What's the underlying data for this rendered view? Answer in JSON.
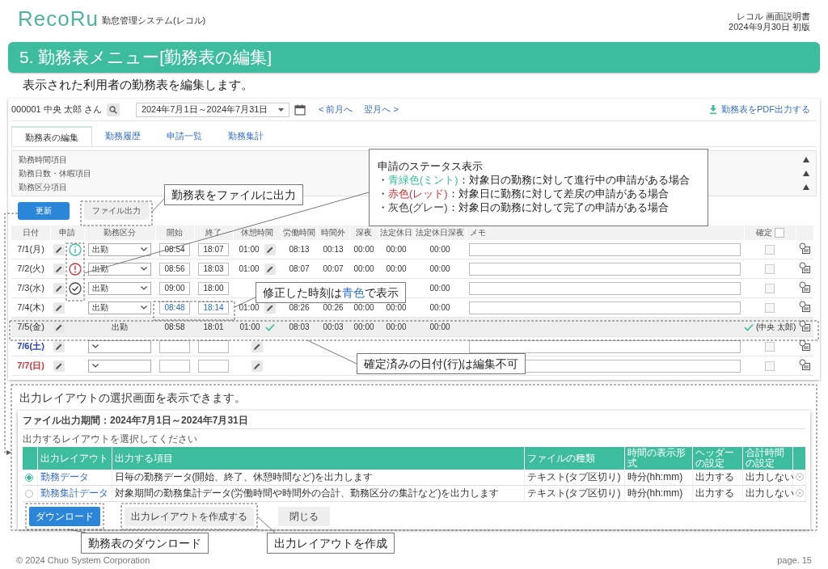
{
  "header": {
    "logo": "RecoRu",
    "system_name": "勤怠管理システム(レコル)",
    "document_title": "レコル 画面説明書",
    "document_date": "2024年9月30日 初版"
  },
  "section_title": "5. 勤務表メニュー[勤務表の編集]",
  "lead": "表示された利用者の勤務表を編集します。",
  "toolbar": {
    "user": "000001 中央 太郎 さん",
    "period": "2024年7月1日～2024年7月31日",
    "prev": "< 前月へ",
    "next": "翌月へ >",
    "pdf": "勤務表をPDF出力する"
  },
  "tabs": [
    {
      "label": "勤務表の編集",
      "selected": true
    },
    {
      "label": "勤務履歴",
      "selected": false
    },
    {
      "label": "申請一覧",
      "selected": false
    },
    {
      "label": "勤務集計",
      "selected": false
    }
  ],
  "sections": [
    {
      "label": "勤務時間項目",
      "expanded": true
    },
    {
      "label": "勤務日数・休暇項目",
      "expanded": true
    },
    {
      "label": "勤務区分項目",
      "expanded": true
    }
  ],
  "buttons": {
    "update": "更新",
    "file_output": "ファイル出力"
  },
  "table": {
    "columns": [
      "日付",
      "申請",
      "勤務区分",
      "開始",
      "終了",
      "休憩時間",
      "労働時間",
      "時間外",
      "深夜",
      "法定休日",
      "法定休日深夜",
      "メモ",
      "確定"
    ],
    "confirm_all_checked": false,
    "rows": [
      {
        "date": "7/1(月)",
        "request": {
          "kind": "in_progress"
        },
        "category": "出勤",
        "start": "08:54",
        "end": "18:07",
        "start_modified": false,
        "end_modified": false,
        "break": "01:00",
        "break_icon": true,
        "work": "08:13",
        "overtime": "00:13",
        "late_night": "00:00",
        "holiday": "00:00",
        "holiday_late_night": "00:00",
        "confirmed": false
      },
      {
        "date": "7/2(火)",
        "request": {
          "kind": "returned"
        },
        "category": "出勤",
        "start": "08:56",
        "end": "18:03",
        "start_modified": false,
        "end_modified": false,
        "break": "01:00",
        "break_icon": true,
        "work": "08:07",
        "overtime": "00:07",
        "late_night": "00:00",
        "holiday": "00:00",
        "holiday_late_night": "00:00",
        "confirmed": false
      },
      {
        "date": "7/3(水)",
        "request": {
          "kind": "completed"
        },
        "category": "出勤",
        "start": "09:00",
        "end": "18:00",
        "start_modified": false,
        "end_modified": false,
        "break_icon": false,
        "holiday_late_night": "00:00",
        "confirmed": false
      },
      {
        "date": "7/4(木)",
        "category": "出勤",
        "start": "08:48",
        "end": "18:14",
        "start_modified": true,
        "end_modified": true,
        "break": "01:00",
        "break_icon": true,
        "work": "08:26",
        "overtime": "00:26",
        "late_night": "00:00",
        "holiday": "00:00",
        "holiday_late_night": "00:00",
        "confirmed": false
      },
      {
        "date": "7/5(金)",
        "category": "出勤",
        "start": "08:58",
        "end": "18:01",
        "break": "01:00",
        "work": "08:03",
        "overtime": "00:03",
        "late_night": "00:00",
        "holiday": "00:00",
        "holiday_late_night": "00:00",
        "confirmed": true,
        "confirmed_by": "(中央 太郎)"
      },
      {
        "date": "7/6(土)",
        "color": "#2440b8",
        "start_modified": false,
        "end_modified": false,
        "break_icon": true,
        "confirmed": false
      },
      {
        "date": "7/7(日)",
        "color": "#d0323a",
        "start_modified": false,
        "end_modified": false,
        "break_icon": true,
        "confirmed": false
      }
    ]
  },
  "callouts": {
    "file_output": "勤務表をファイルに出力",
    "status": {
      "title": "申請のステータス表示",
      "lines": [
        {
          "bullet": "・",
          "term": "青緑色(ミント)",
          "text": "：対象日の勤務に対して進行中の申請がある場合",
          "color": "#3dbda0"
        },
        {
          "bullet": "・",
          "term": "赤色(レッド)",
          "text": "：対象日に勤務に対して差戻の申請がある場合",
          "color": "#d0323a"
        },
        {
          "bullet": "・",
          "term": "灰色(グレー)",
          "text": "：対象日の勤務に対して完了の申請がある場合",
          "color": "#444444"
        }
      ]
    },
    "modified": {
      "before": "修正した時刻は",
      "highlight": "青色",
      "after": "で表示"
    },
    "confirmed": "確定済みの日付(行)は編集不可",
    "download": "勤務表のダウンロード",
    "create_layout": "出力レイアウトを作成"
  },
  "dialog_note": "出力レイアウトの選択画面を表示できます。",
  "dialog": {
    "title": "ファイル出力期間：2024年7月1日～2024年7月31日",
    "prompt": "出力するレイアウトを選択してください",
    "columns": [
      "出力レイアウト",
      "出力する項目",
      "ファイルの種類",
      "時間の表示形式",
      "ヘッダーの設定",
      "合計時間の設定"
    ],
    "rows": [
      {
        "selected": true,
        "layout": "勤務データ",
        "items": "日毎の勤務データ(開始、終了、休憩時間など)を出力します",
        "file_type": "テキスト(タブ区切り)",
        "time_format": "時分(hh:mm)",
        "header": "出力する",
        "total": "出力しない"
      },
      {
        "selected": false,
        "layout": "勤務集計データ",
        "items": "対象期間の勤務集計データ(労働時間や時間外の合計、勤務区分の集計など)を出力します",
        "file_type": "テキスト(タブ区切り)",
        "time_format": "時分(hh:mm)",
        "header": "出力する",
        "total": "出力しない"
      }
    ],
    "buttons": {
      "download": "ダウンロード",
      "create": "出力レイアウトを作成する",
      "close": "閉じる"
    }
  },
  "footer": {
    "copyright": "© 2024 Chuo System Corporation",
    "page": "page. 15"
  }
}
